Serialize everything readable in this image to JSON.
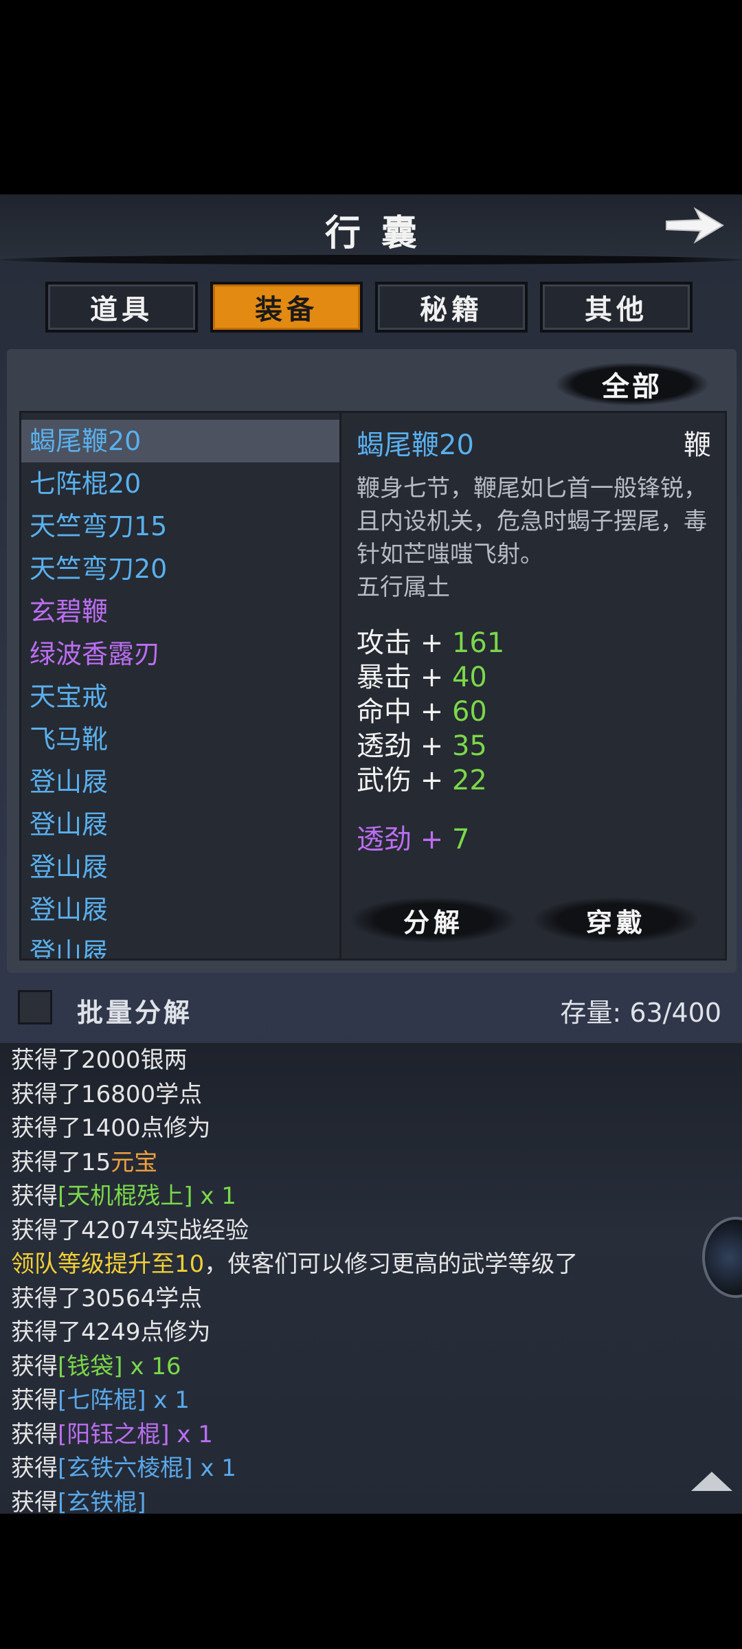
{
  "header": {
    "title": "行囊"
  },
  "tabs": [
    {
      "label": "道具",
      "active": false
    },
    {
      "label": "装备",
      "active": true
    },
    {
      "label": "秘籍",
      "active": false
    },
    {
      "label": "其他",
      "active": false
    }
  ],
  "filter": {
    "label": "全部"
  },
  "items": [
    {
      "name": "蝎尾鞭20",
      "color": "#59b0ee",
      "selected": true
    },
    {
      "name": "七阵棍20",
      "color": "#59b0ee"
    },
    {
      "name": "天竺弯刀15",
      "color": "#59b0ee"
    },
    {
      "name": "天竺弯刀20",
      "color": "#59b0ee"
    },
    {
      "name": "玄碧鞭",
      "color": "#bb6ef2"
    },
    {
      "name": "绿波香露刃",
      "color": "#bb6ef2"
    },
    {
      "name": "天宝戒",
      "color": "#59b0ee"
    },
    {
      "name": "飞马靴",
      "color": "#59b0ee"
    },
    {
      "name": "登山屐",
      "color": "#59b0ee"
    },
    {
      "name": "登山屐",
      "color": "#59b0ee"
    },
    {
      "name": "登山屐",
      "color": "#59b0ee"
    },
    {
      "name": "登山屐",
      "color": "#59b0ee"
    },
    {
      "name": "登山屐",
      "color": "#59b0ee"
    }
  ],
  "detail": {
    "name": "蝎尾鞭20",
    "type": "鞭",
    "description": "鞭身七节，鞭尾如匕首一般锋锐，且内设机关，危急时蝎子摆尾，毒针如芒嗤嗤飞射。",
    "element": "五行属土",
    "stats": [
      {
        "name": "攻击",
        "op": "+",
        "value": "161"
      },
      {
        "name": "暴击",
        "op": "+",
        "value": "40"
      },
      {
        "name": "命中",
        "op": "+",
        "value": "60"
      },
      {
        "name": "透劲",
        "op": "+",
        "value": "35"
      },
      {
        "name": "武伤",
        "op": "+",
        "value": "22"
      }
    ],
    "bonus": {
      "name": "透劲",
      "op": "+",
      "value": "7"
    },
    "decompose_label": "分解",
    "equip_label": "穿戴"
  },
  "batch": {
    "label": "批量分解"
  },
  "capacity": {
    "label": "存量:",
    "value": "63/400"
  },
  "log": [
    [
      {
        "t": "获得了2000银两"
      }
    ],
    [
      {
        "t": "获得了16800学点"
      }
    ],
    [
      {
        "t": "获得了1400点修为"
      }
    ],
    [
      {
        "t": "获得了15"
      },
      {
        "t": "元宝",
        "c": "o"
      }
    ],
    [
      {
        "t": "获得"
      },
      {
        "t": "[天机棍残上]",
        "c": "g"
      },
      {
        "t": " x 1",
        "c": "g"
      }
    ],
    [
      {
        "t": "获得了42074实战经验"
      }
    ],
    [
      {
        "t": "领队等级提升至10",
        "c": "y"
      },
      {
        "t": "，侠客们可以修习更高的武学等级了"
      }
    ],
    [
      {
        "t": "获得了30564学点"
      }
    ],
    [
      {
        "t": "获得了4249点修为"
      }
    ],
    [
      {
        "t": "获得"
      },
      {
        "t": "[钱袋]",
        "c": "g"
      },
      {
        "t": " x 16",
        "c": "g"
      }
    ],
    [
      {
        "t": "获得"
      },
      {
        "t": "[七阵棍]",
        "c": "b"
      },
      {
        "t": " x 1",
        "c": "b"
      }
    ],
    [
      {
        "t": "获得"
      },
      {
        "t": "[阳钰之棍]",
        "c": "p"
      },
      {
        "t": " x 1",
        "c": "p"
      }
    ],
    [
      {
        "t": "获得"
      },
      {
        "t": "[玄铁六棱棍]",
        "c": "b"
      },
      {
        "t": " x 1",
        "c": "b"
      }
    ],
    [
      {
        "t": "获得"
      },
      {
        "t": "[玄铁棍]",
        "c": "b"
      }
    ]
  ]
}
